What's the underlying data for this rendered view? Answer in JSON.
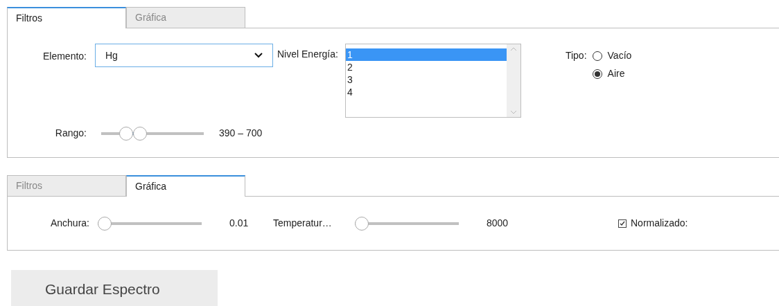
{
  "filters_panel": {
    "tabs": [
      {
        "label": "Filtros",
        "selected": true
      },
      {
        "label": "Gráfica",
        "selected": false
      }
    ],
    "element": {
      "label": "Elemento:",
      "value": "Hg"
    },
    "energy_level": {
      "label": "Nivel Energía:",
      "options": [
        {
          "label": "1",
          "selected": true
        },
        {
          "label": "2",
          "selected": false
        },
        {
          "label": "3",
          "selected": false
        },
        {
          "label": "4",
          "selected": false
        }
      ]
    },
    "type": {
      "label": "Tipo:",
      "options": [
        {
          "label": "Vacío",
          "selected": false
        },
        {
          "label": "Aire",
          "selected": true
        }
      ]
    },
    "range": {
      "label": "Rango:",
      "thumbs": [
        {
          "level": 0.2
        },
        {
          "level": 0.36
        }
      ],
      "reading": "390 – 700"
    }
  },
  "chart_panel": {
    "tabs": [
      {
        "label": "Filtros",
        "selected": false
      },
      {
        "label": "Gráfica",
        "selected": true
      }
    ],
    "sliders": [
      {
        "label": "Anchura:",
        "level": 0,
        "reading": "0.01"
      },
      {
        "label": "Temperatur…",
        "level": 0,
        "reading": "8000"
      }
    ],
    "normalized": {
      "label": "Normalizado:",
      "checked": true
    }
  },
  "save_button": "Guardar Espectro"
}
